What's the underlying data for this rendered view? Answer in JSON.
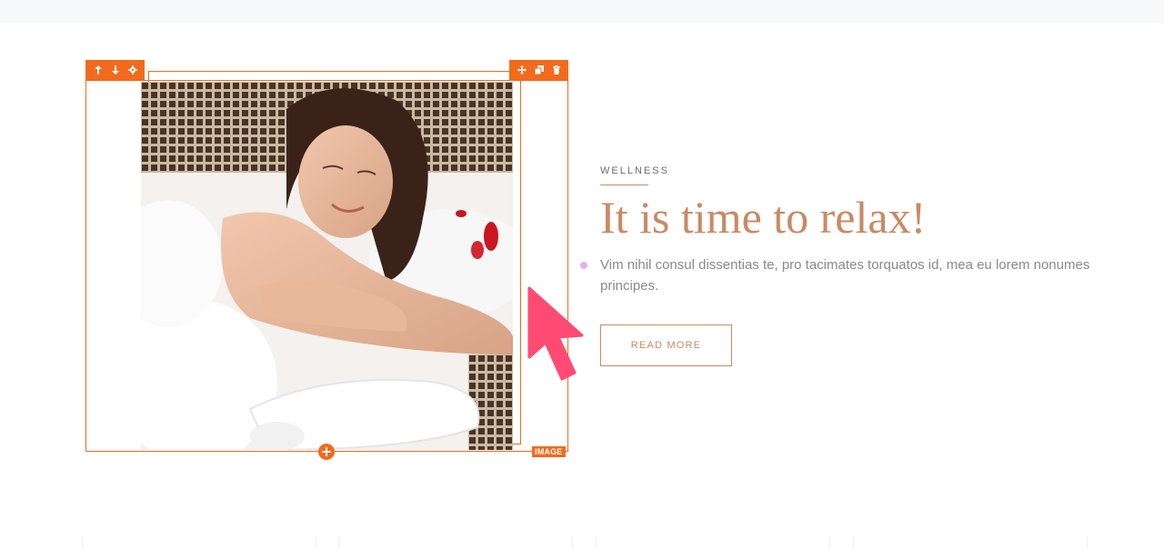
{
  "editor": {
    "left_toolbar": [
      {
        "name": "move-up-icon",
        "glyph": "↑"
      },
      {
        "name": "move-down-icon",
        "glyph": "↓"
      },
      {
        "name": "settings-icon",
        "glyph": "⚙"
      }
    ],
    "right_toolbar": [
      {
        "name": "drag-move-icon"
      },
      {
        "name": "duplicate-icon"
      },
      {
        "name": "delete-icon"
      }
    ],
    "element_type_label": "IMAGE",
    "accent_color": "#f26b1d"
  },
  "content": {
    "eyebrow": "WELLNESS",
    "heading": "It is time to relax!",
    "body": "Vim nihil consul dissentias te, pro tacimates torquatos id, mea eu lorem nonumes principes.",
    "button_label": "READ MORE",
    "accent_color": "#c98a64"
  }
}
